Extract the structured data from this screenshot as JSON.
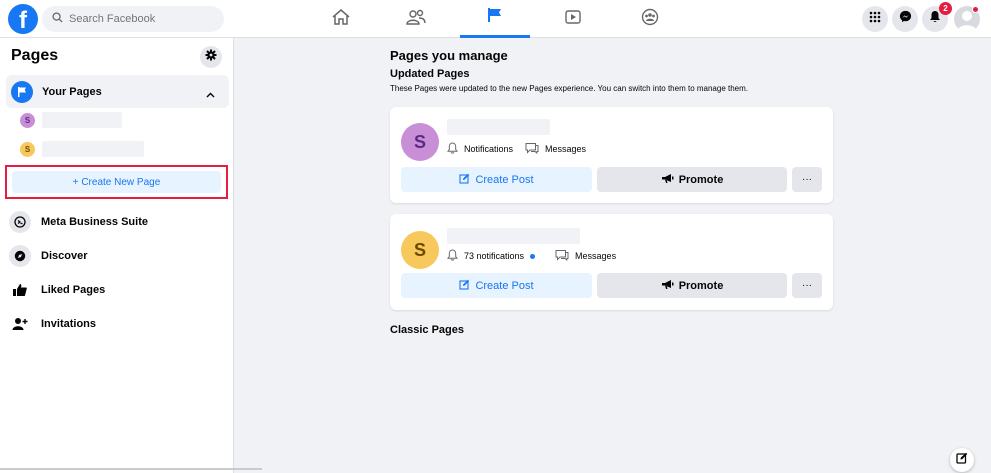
{
  "topbar": {
    "logo_letter": "f",
    "search_placeholder": "Search Facebook",
    "notification_count": "2"
  },
  "sidebar": {
    "title": "Pages",
    "your_pages_label": "Your Pages",
    "sub_pages": [
      {
        "initial": "S",
        "color": "#c98fd6"
      },
      {
        "initial": "S",
        "color": "#f7c85c"
      }
    ],
    "create_page_label": "+ Create New Page",
    "items": [
      {
        "label": "Meta Business Suite",
        "icon": "meta-business-icon"
      },
      {
        "label": "Discover",
        "icon": "discover-icon"
      },
      {
        "label": "Liked Pages",
        "icon": "like-icon"
      },
      {
        "label": "Invitations",
        "icon": "invite-icon"
      }
    ]
  },
  "main": {
    "title": "Pages you manage",
    "updated_title": "Updated Pages",
    "updated_desc": "These Pages were updated to the new Pages experience. You can switch into them to manage them.",
    "cards": [
      {
        "initial": "S",
        "avatar_color": "#c98fd6",
        "avatar_text_color": "#5b2a86",
        "notifications_label": "Notifications",
        "messages_label": "Messages",
        "create_post_label": "Create Post",
        "promote_label": "Promote",
        "more_label": "···"
      },
      {
        "initial": "S",
        "avatar_color": "#f7c85c",
        "avatar_text_color": "#6b4a00",
        "notifications_label": "73 notifications",
        "messages_label": "Messages",
        "create_post_label": "Create Post",
        "promote_label": "Promote",
        "more_label": "···"
      }
    ],
    "classic_title": "Classic Pages"
  },
  "colors": {
    "accent": "#1877f2",
    "highlight_border": "#e41e3f"
  }
}
